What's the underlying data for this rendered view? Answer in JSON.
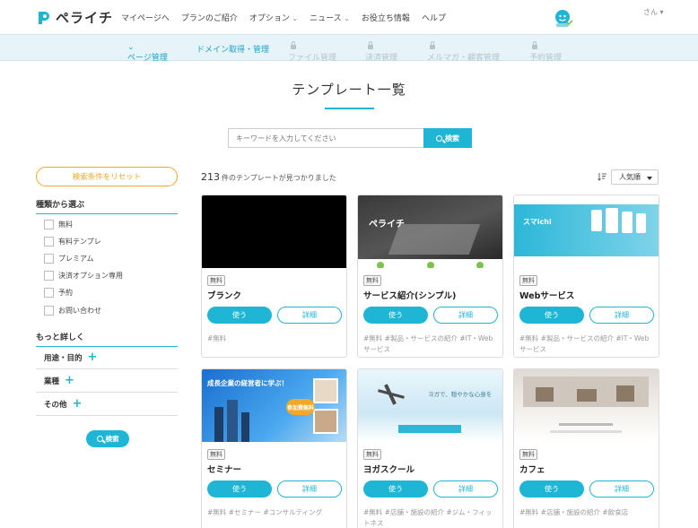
{
  "header": {
    "logo": "ペライチ",
    "nav": [
      "マイページへ",
      "プランのご紹介",
      "オプション",
      "ニュース",
      "お役立ち情報",
      "ヘルプ"
    ],
    "user": "さん"
  },
  "subnav": {
    "page_mgmt": "ページ管理",
    "domain": "ドメイン取得・管理",
    "file": "ファイル管理",
    "payment": "決済管理",
    "mail": "メルマガ・顧客管理",
    "reserve": "予約管理"
  },
  "title": "テンプレート一覧",
  "search": {
    "placeholder": "キーワードを入力してください",
    "button": "検索"
  },
  "sidebar": {
    "reset": "検索条件をリセット",
    "type_heading": "種類から選ぶ",
    "types": [
      "無料",
      "有料テンプレ",
      "プレミアム",
      "決済オプション専用",
      "予約",
      "お問い合わせ"
    ],
    "more_heading": "もっと詳しく",
    "accordions": [
      "用途・目的",
      "業種",
      "その他"
    ],
    "search_button": "検索"
  },
  "results": {
    "count": "213",
    "count_suffix": "件のテンプレートが見つかりました",
    "sort": "人気順"
  },
  "cards": [
    {
      "badge": "無料",
      "name": "ブランク",
      "use": "使う",
      "detail": "詳細",
      "tags": "#無料"
    },
    {
      "badge": "無料",
      "name": "サービス紹介(シンプル)",
      "use": "使う",
      "detail": "詳細",
      "tags": "#無料 #製品・サービスの紹介 #IT・Webサービス",
      "thumb_text": "ペライチ"
    },
    {
      "badge": "無料",
      "name": "Webサービス",
      "use": "使う",
      "detail": "詳細",
      "tags": "#無料 #製品・サービスの紹介 #IT・Webサービス",
      "thumb_text": "スマichi"
    },
    {
      "badge": "無料",
      "name": "セミナー",
      "use": "使う",
      "detail": "詳細",
      "tags": "#無料 #セミナー #コンサルティング",
      "thumb_text": "成長企業の経営者に学ぶ！",
      "thumb_badge": "参加費無料"
    },
    {
      "badge": "無料",
      "name": "ヨガスクール",
      "use": "使う",
      "detail": "詳細",
      "tags": "#無料 #店舗・施設の紹介 #ジム・フィットネス",
      "thumb_text": "ヨガで、穏やかな心身を"
    },
    {
      "badge": "無料",
      "name": "カフェ",
      "use": "使う",
      "detail": "詳細",
      "tags": "#無料 #店舗・施設の紹介 #飲食店"
    }
  ]
}
